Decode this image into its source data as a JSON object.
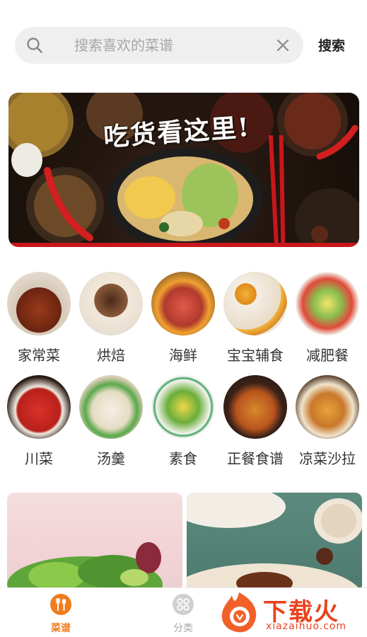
{
  "search": {
    "placeholder": "搜索喜欢的菜谱",
    "button_label": "搜索"
  },
  "banner": {
    "title": "吃货看这里!"
  },
  "categories": [
    {
      "label": "家常菜"
    },
    {
      "label": "烘焙"
    },
    {
      "label": "海鲜"
    },
    {
      "label": "宝宝辅食"
    },
    {
      "label": "减肥餐"
    },
    {
      "label": "川菜"
    },
    {
      "label": "汤羹"
    },
    {
      "label": "素食"
    },
    {
      "label": "正餐食谱"
    },
    {
      "label": "凉菜沙拉"
    }
  ],
  "bottom_nav": {
    "items": [
      {
        "label": "菜谱",
        "icon": "fork-spoon-icon",
        "active": true
      },
      {
        "label": "分类",
        "icon": "grid-circles-icon",
        "active": false
      }
    ]
  },
  "watermark": {
    "title": "下载火",
    "url": "xiazaihuo.com"
  },
  "colors": {
    "accent": "#f07c1e",
    "search_bg": "#efefef",
    "watermark": "#e8431d"
  }
}
